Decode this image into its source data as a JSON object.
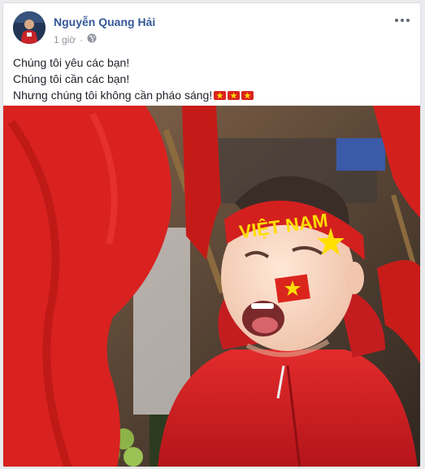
{
  "post": {
    "author": "Nguyễn Quang Hải",
    "time": "1 giờ",
    "privacy_icon": "globe-icon",
    "lines": [
      "Chúng tôi yêu các bạn!",
      "Chúng tôi cần các bạn!",
      "Nhưng chúng tôi không cần pháo sáng!"
    ],
    "line3_emoji": [
      "vietnam-flag-emoji",
      "vietnam-flag-emoji",
      "vietnam-flag-emoji"
    ]
  },
  "photo": {
    "headband_text": "VIỆT NAM"
  },
  "colors": {
    "link": "#365899",
    "flag_red": "#da251d",
    "flag_star": "#ffde00"
  }
}
